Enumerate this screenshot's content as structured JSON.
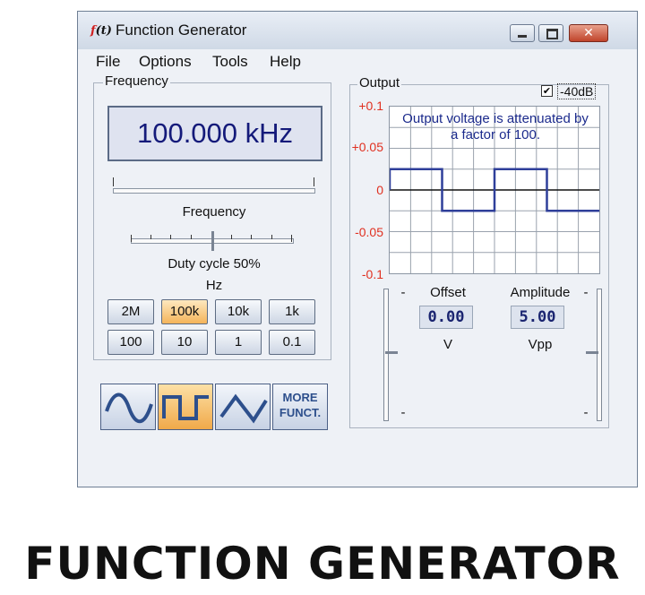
{
  "window": {
    "title": "Function Generator",
    "icon_text_f": "f",
    "icon_text_t": "(t)"
  },
  "menu": [
    "File",
    "Options",
    "Tools",
    "Help"
  ],
  "frequency": {
    "group_label": "Frequency",
    "display": "100.000 kHz",
    "slider_label": "Frequency",
    "duty_label": "Duty cycle 50%",
    "duty_value_percent": 50,
    "units_label": "Hz",
    "range_buttons": [
      "2M",
      "100k",
      "10k",
      "1k",
      "100",
      "10",
      "1",
      "0.1"
    ],
    "selected_range": "100k"
  },
  "waveforms": {
    "buttons": [
      "sine-wave-icon",
      "square-wave-icon",
      "triangle-wave-icon"
    ],
    "selected": "square-wave-icon",
    "more_line1": "MORE",
    "more_line2": "FUNCT."
  },
  "output": {
    "group_label": "Output",
    "attenuation_label": "-40dB",
    "attenuation_checked": true,
    "note": "Output voltage is attenuated by a factor of 100.",
    "y_ticks": [
      "+0.1",
      "+0.05",
      "0",
      "-0.05",
      "-0.1"
    ],
    "offset_label": "Offset",
    "offset_value": "0.00",
    "offset_unit": "V",
    "amplitude_label": "Amplitude",
    "amplitude_value": "5.00",
    "amplitude_unit": "Vpp",
    "slider_minus": "-"
  },
  "chart_data": {
    "type": "line",
    "ylim": [
      -0.1,
      0.1
    ],
    "series": [
      {
        "x": [
          0,
          0,
          2.5,
          2.5,
          5,
          5,
          7.5,
          7.5,
          10
        ],
        "y": [
          0,
          0.025,
          0.025,
          -0.025,
          -0.025,
          0.025,
          0.025,
          -0.025,
          -0.025
        ]
      }
    ],
    "grid": true
  },
  "colors": {
    "trace": "#2f3f9a",
    "axis_text": "#e03020",
    "accent": "#f0a94a"
  },
  "caption": "FUNCTION GENERATOR"
}
